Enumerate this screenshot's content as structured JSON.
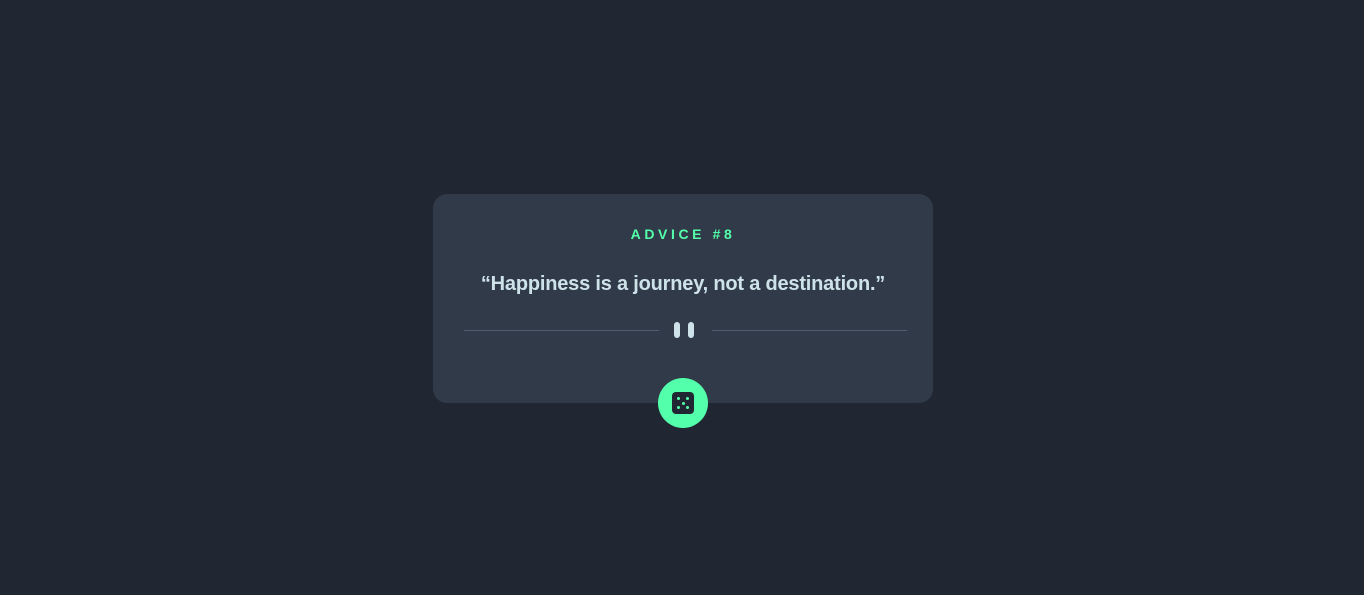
{
  "card": {
    "advice_label": "ADVICE #8",
    "quote": "“Happiness is a journey, not a destination.”"
  },
  "icons": {
    "divider": "pause-icon",
    "generate": "dice-icon"
  },
  "colors": {
    "background": "#202632",
    "card": "#313a48",
    "accent": "#53ffaa",
    "text": "#cee3e9",
    "divider": "#4f5d74"
  }
}
